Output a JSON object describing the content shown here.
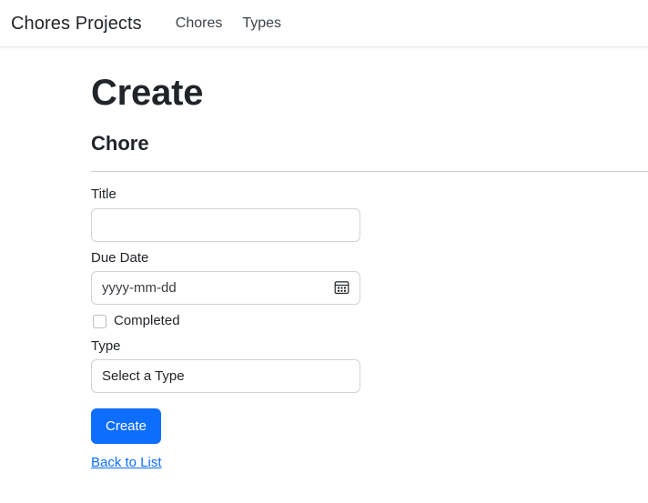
{
  "navbar": {
    "brand": "Chores Projects",
    "links": [
      {
        "label": "Chores"
      },
      {
        "label": "Types"
      }
    ]
  },
  "page": {
    "title": "Create",
    "subtitle": "Chore"
  },
  "form": {
    "title_field": {
      "label": "Title",
      "value": "",
      "placeholder": ""
    },
    "due_date_field": {
      "label": "Due Date",
      "value": "",
      "placeholder": "yyyy-mm-dd",
      "icon": "calendar-icon"
    },
    "completed_field": {
      "label": "Completed",
      "checked": false
    },
    "type_field": {
      "label": "Type",
      "selected": "Select a Type",
      "options": [
        "Select a Type"
      ]
    },
    "submit_label": "Create",
    "back_link_label": "Back to List"
  },
  "colors": {
    "primary": "#0d6efd",
    "text": "#212529",
    "border": "#ced4da",
    "divider": "#c9ccd0",
    "navbar_border": "#e6e6e6"
  }
}
